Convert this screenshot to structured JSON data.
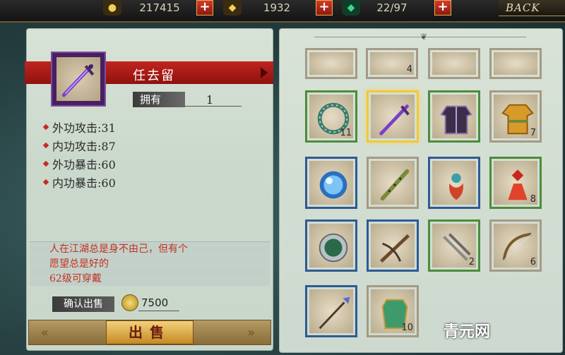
{
  "topbar": {
    "resources": [
      {
        "icon": "coin-icon",
        "value": "217415"
      },
      {
        "icon": "ingot-icon",
        "value": "1932"
      },
      {
        "icon": "jade-icon",
        "value": "22/97"
      }
    ],
    "plus_label": "+",
    "back_label": "BACK"
  },
  "item": {
    "name": "任去留",
    "own_label": "拥有",
    "own_count": "1",
    "stats": [
      "外功攻击:31",
      "内功攻击:87",
      "外功暴击:60",
      "内功暴击:60"
    ],
    "description": [
      "人在江湖总是身不由己，但有个",
      "愿望总是好的",
      "62级可穿戴"
    ]
  },
  "sell": {
    "confirm_label": "确认出售",
    "price": "7500",
    "button_label": "出售",
    "left_chevron": "«",
    "right_chevron": "»"
  },
  "inventory": {
    "top_row_qty": [
      "",
      "4",
      "",
      ""
    ],
    "cells": [
      {
        "name": "jade-ring",
        "border": "green",
        "qty": "11"
      },
      {
        "name": "purple-sword",
        "border": "selected",
        "qty": ""
      },
      {
        "name": "purple-armor",
        "border": "green",
        "qty": ""
      },
      {
        "name": "gold-robe",
        "border": "none",
        "qty": "7"
      },
      {
        "name": "blue-orb",
        "border": "blue",
        "qty": ""
      },
      {
        "name": "bamboo-flute",
        "border": "none",
        "qty": ""
      },
      {
        "name": "ornament-charm",
        "border": "blue",
        "qty": ""
      },
      {
        "name": "red-tassel",
        "border": "green",
        "qty": "8"
      },
      {
        "name": "jade-medallion",
        "border": "blue",
        "qty": ""
      },
      {
        "name": "crossbow",
        "border": "blue",
        "qty": ""
      },
      {
        "name": "throwing-darts",
        "border": "green",
        "qty": "2"
      },
      {
        "name": "longbow",
        "border": "none",
        "qty": "6"
      },
      {
        "name": "spear",
        "border": "blue",
        "qty": ""
      },
      {
        "name": "green-vest",
        "border": "none",
        "qty": "10"
      }
    ]
  },
  "watermark": "青元网"
}
